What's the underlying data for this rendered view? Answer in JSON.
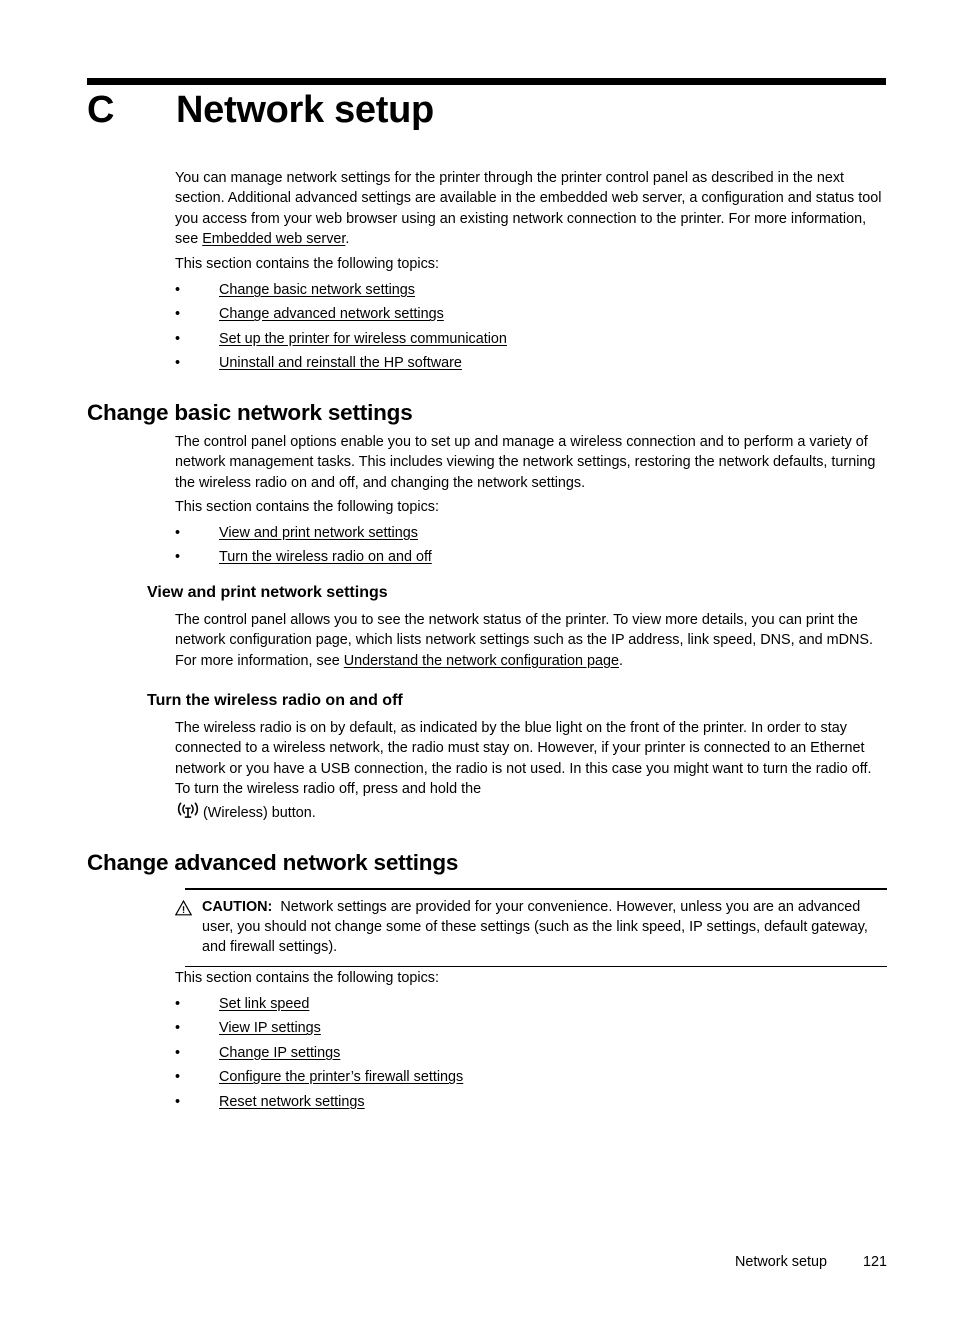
{
  "chapter": {
    "letter": "C",
    "title": "Network setup"
  },
  "intro": {
    "paragraph_before_link": "You can manage network settings for the printer through the printer control panel as described in the next section. Additional advanced settings are available in the embedded web server, a configuration and status tool you access from your web browser using an existing network connection to the printer. For more information, see ",
    "link": "Embedded web server",
    "paragraph_after_link": ".",
    "topics_lead": "This section contains the following topics:",
    "topics": [
      "Change basic network settings",
      "Change advanced network settings",
      "Set up the printer for wireless communication",
      "Uninstall and reinstall the HP software"
    ]
  },
  "basic": {
    "heading": "Change basic network settings",
    "paragraph": "The control panel options enable you to set up and manage a wireless connection and to perform a variety of network management tasks. This includes viewing the network settings, restoring the network defaults, turning the wireless radio on and off, and changing the network settings.",
    "topics_lead": "This section contains the following topics:",
    "topics": [
      "View and print network settings",
      "Turn the wireless radio on and off"
    ]
  },
  "view_print": {
    "heading": "View and print network settings",
    "text_before_link": "The control panel allows you to see the network status of the printer. To view more details, you can print the network configuration page, which lists network settings such as the IP address, link speed, DNS, and mDNS. For more information, see ",
    "link": "Understand the network configuration page",
    "text_after_link": "."
  },
  "wireless_radio": {
    "heading": "Turn the wireless radio on and off",
    "paragraph": "The wireless radio is on by default, as indicated by the blue light on the front of the printer. In order to stay connected to a wireless network, the radio must stay on. However, if your printer is connected to an Ethernet network or you have a USB connection, the radio is not used. In this case you might want to turn the radio off. To turn the wireless radio off, press and hold the",
    "button_caption": "(Wireless) button.",
    "icon_name": "wireless-antenna-icon"
  },
  "advanced": {
    "heading": "Change advanced network settings",
    "caution": {
      "icon_name": "caution-triangle-icon",
      "label": "CAUTION:",
      "text": "Network settings are provided for your convenience. However, unless you are an advanced user, you should not change some of these settings (such as the link speed, IP settings, default gateway, and firewall settings)."
    },
    "topics_lead": "This section contains the following topics:",
    "topics": [
      "Set link speed",
      "View IP settings",
      "Change IP settings",
      "Configure the printer’s firewall settings",
      "Reset network settings"
    ]
  },
  "footer": {
    "title": "Network setup",
    "page_number": "121"
  },
  "bullet_glyph": "•",
  "colors": {
    "text": "#000000",
    "background": "#ffffff",
    "rule": "#000000"
  }
}
